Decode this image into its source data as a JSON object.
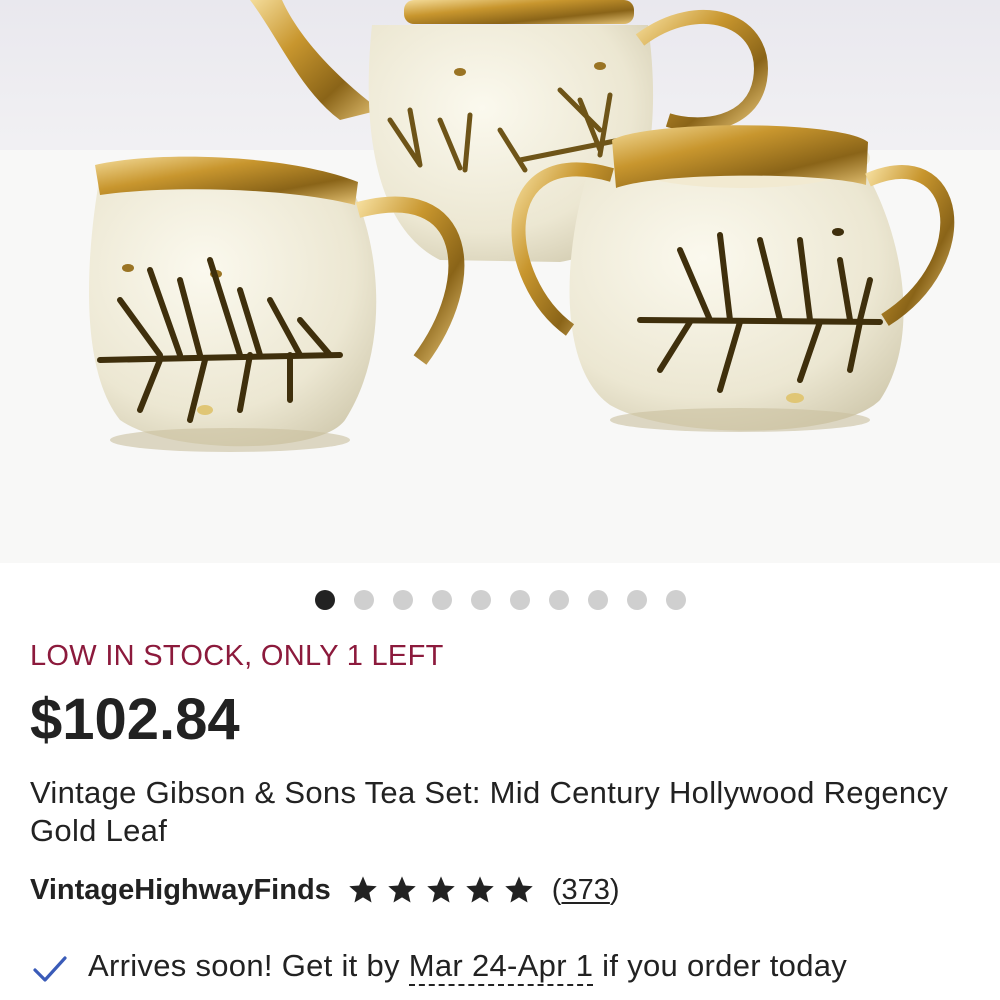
{
  "listing": {
    "image_alt": "Gold leaf tea set: teapot, creamer and sugar bowl",
    "carousel": {
      "total": 10,
      "active": 1
    },
    "stock_text": "LOW IN STOCK, ONLY 1 LEFT",
    "price": "$102.84",
    "title": "Vintage Gibson & Sons Tea Set: Mid Century Hollywood Regency Gold Leaf",
    "shop_name": "VintageHighwayFinds",
    "rating_stars": 5,
    "reviews_open": "(",
    "review_count": "373",
    "reviews_close": ")",
    "delivery": {
      "prefix": "Arrives soon! Get it by ",
      "date": "Mar 24-Apr 1",
      "suffix": " if you order today"
    }
  },
  "colors": {
    "stock": "#8c1a3c",
    "check": "#3a5bb8",
    "dot_active": "#222222",
    "dot_inactive": "#cfcfcf",
    "gold": "#c8962e"
  },
  "icons": {
    "check": "check-icon",
    "star": "star-icon"
  }
}
